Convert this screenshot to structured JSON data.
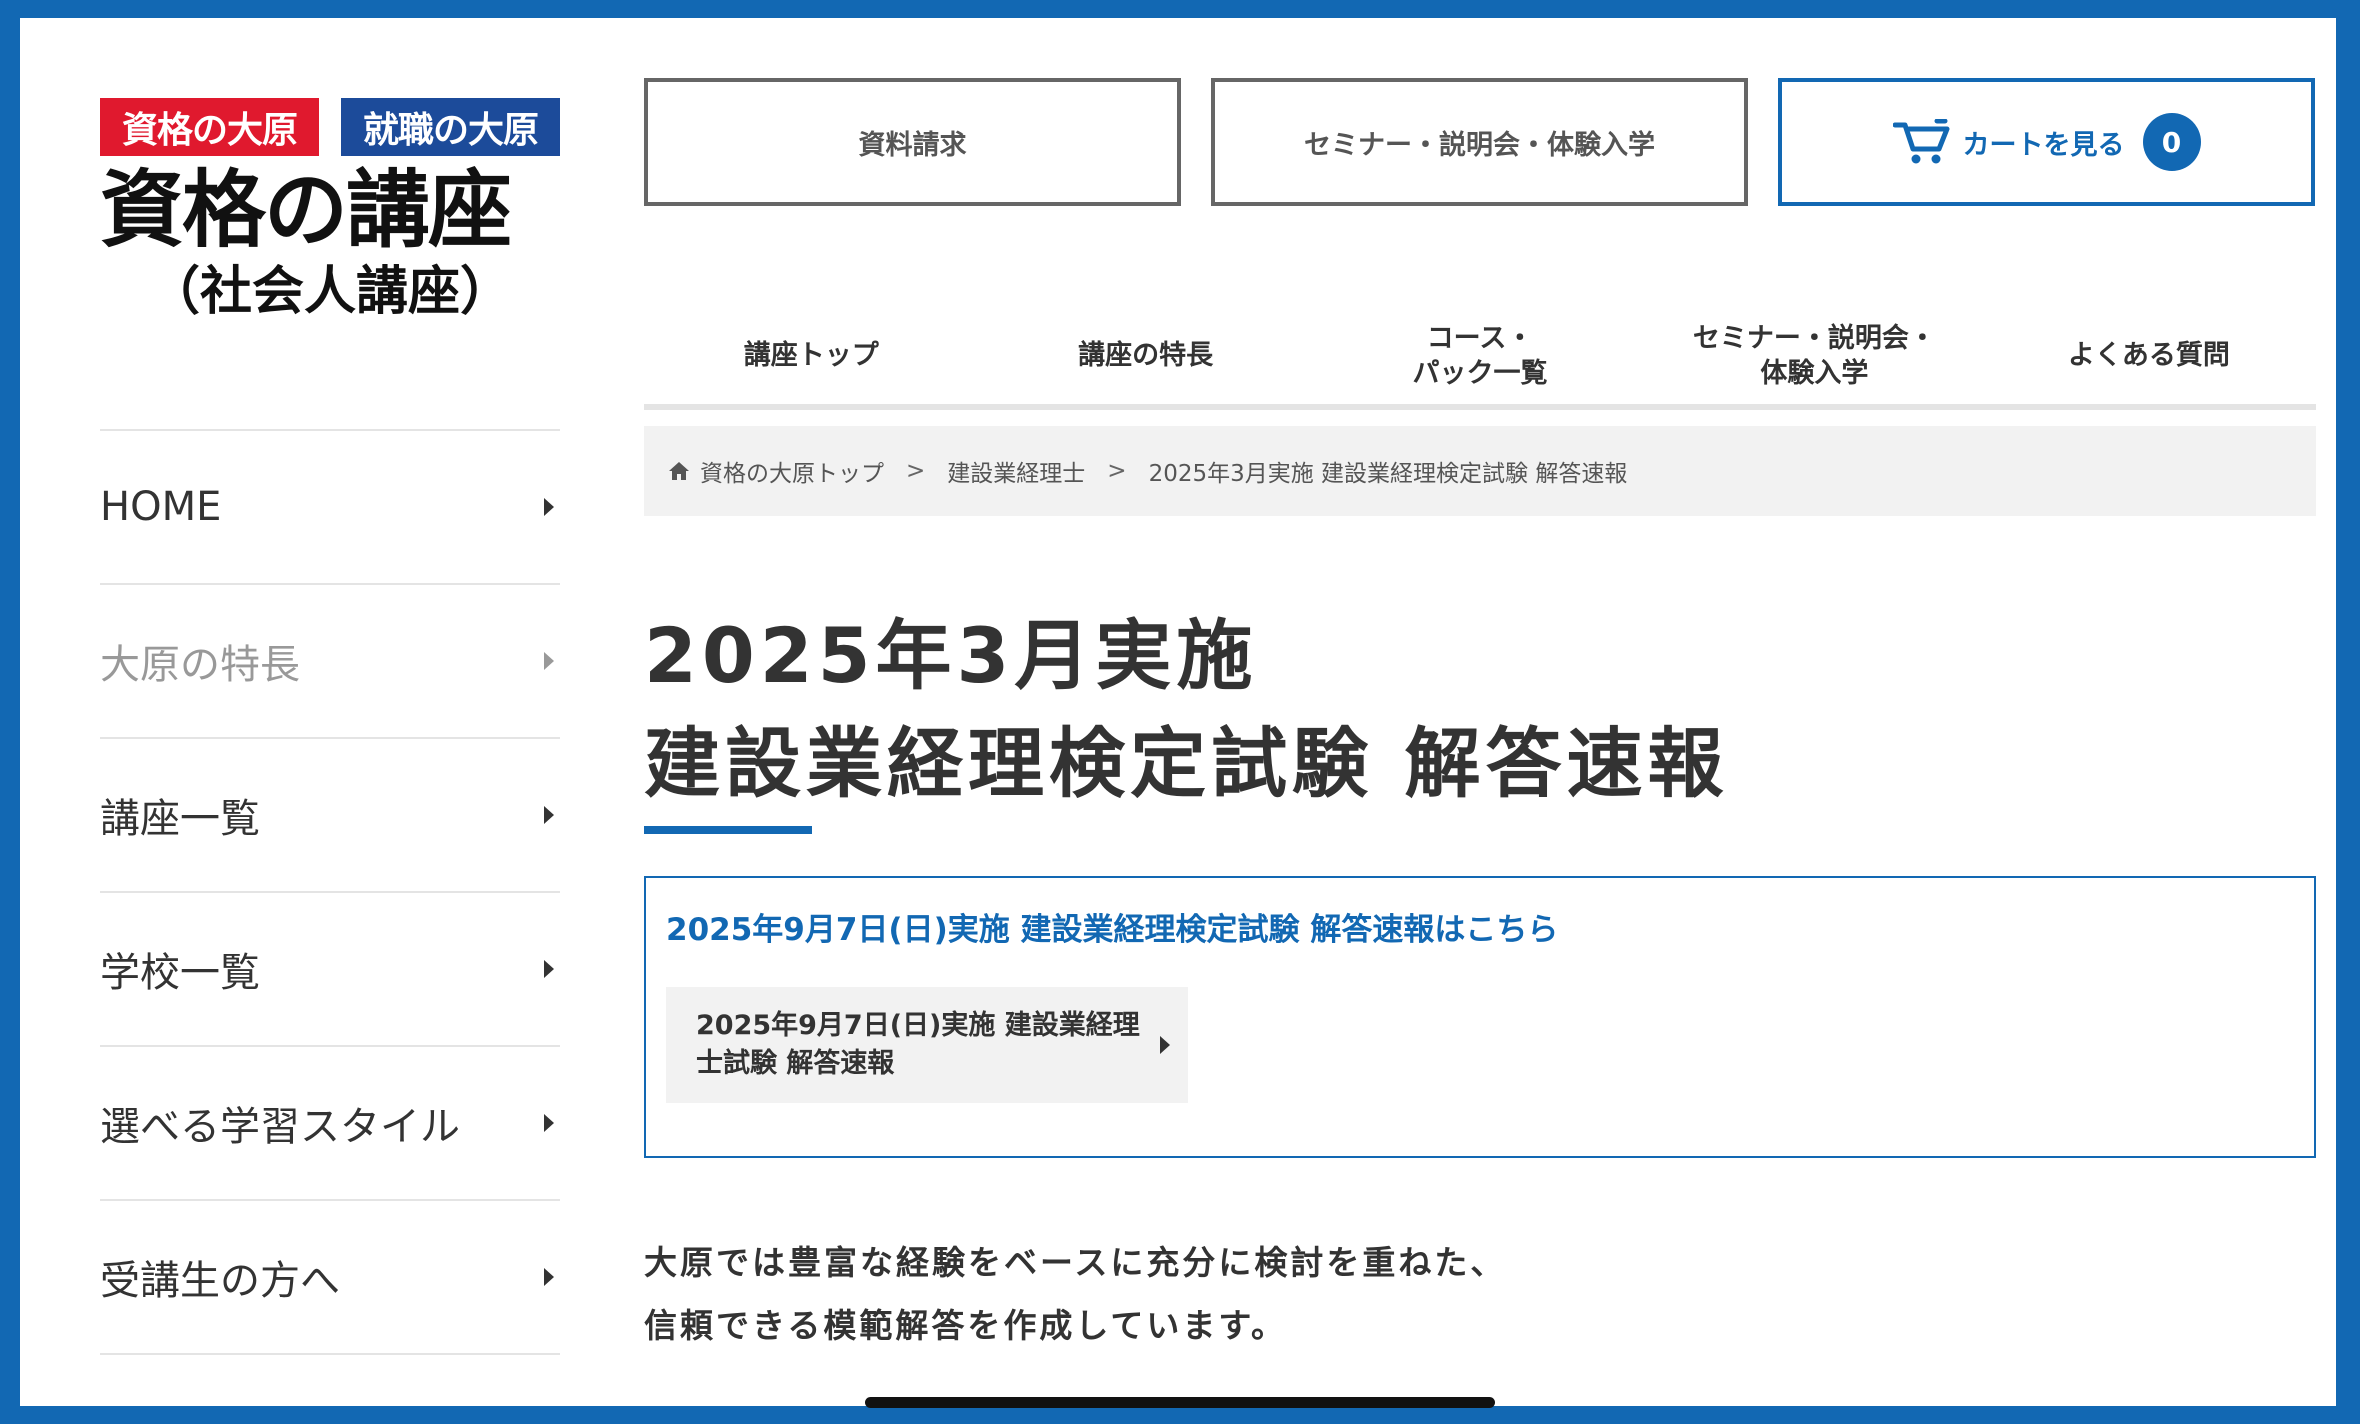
{
  "logo": {
    "badge_shikaku": "資格の大原",
    "badge_shushoku": "就職の大原",
    "title": "資格の講座",
    "subtitle": "（社会人講座）"
  },
  "sidebar": {
    "items": [
      {
        "label": "HOME"
      },
      {
        "label": "大原の特長"
      },
      {
        "label": "講座一覧"
      },
      {
        "label": "学校一覧"
      },
      {
        "label": "選べる学習スタイル"
      },
      {
        "label": "受講生の方へ"
      }
    ]
  },
  "top_buttons": {
    "request": "資料請求",
    "seminar": "セミナー・説明会・体験入学",
    "cart": "カートを見る",
    "cart_count": "0"
  },
  "main_nav": {
    "items": [
      {
        "label": "講座トップ"
      },
      {
        "label": "講座の特長"
      },
      {
        "label": "コース・\nパック一覧"
      },
      {
        "label": "セミナー・説明会・\n体験入学"
      },
      {
        "label": "よくある質問"
      }
    ]
  },
  "breadcrumb": {
    "items": [
      {
        "label": "資格の大原トップ"
      },
      {
        "label": "建設業経理士"
      },
      {
        "label": "2025年3月実施 建設業経理検定試験 解答速報"
      }
    ],
    "separator": ">"
  },
  "page": {
    "title_line1": "2025年3月実施",
    "title_line2": "建設業経理検定試験 解答速報"
  },
  "infobox": {
    "link": "2025年9月7日(日)実施 建設業経理検定試験 解答速報はこちら",
    "card": "2025年9月7日(日)実施 建設業経理士試験 解答速報"
  },
  "lead": {
    "line1": "大原では豊富な経験をベースに充分に検討を重ねた、",
    "line2": "信頼できる模範解答を作成しています。"
  },
  "colors": {
    "brand_blue": "#1268b3",
    "badge_red": "#e0192e",
    "badge_navy": "#1c4b9a"
  }
}
